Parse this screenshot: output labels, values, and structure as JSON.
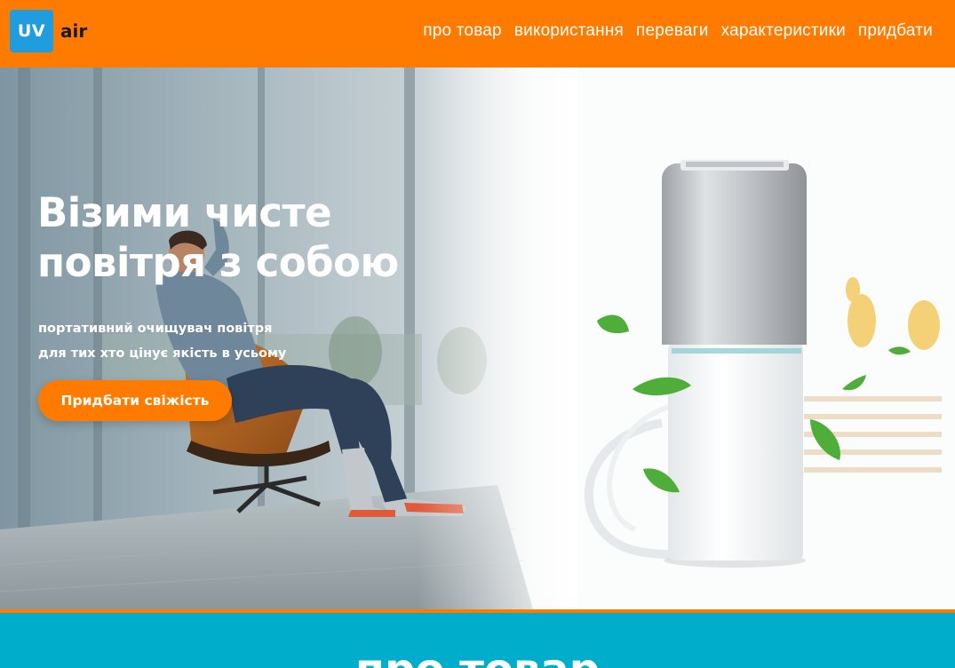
{
  "brand": {
    "logo_mark": "UV",
    "logo_text": "air",
    "primary_color": "#ff7b00",
    "logo_color": "#1f9ddf",
    "section_color": "#00aecb"
  },
  "nav": {
    "items": [
      {
        "label": "про товар"
      },
      {
        "label": "використання"
      },
      {
        "label": "переваги"
      },
      {
        "label": "характеристики"
      },
      {
        "label": "придбати"
      }
    ]
  },
  "hero": {
    "title_line1": "Візими чисте",
    "title_line2": "повітря з собою",
    "subtitle_line1": "портативний очищувач повітря",
    "subtitle_line2": "для тих хто цінує якість в усьому",
    "cta_label": "Придбати свіжість",
    "image_subjects": [
      "man-relaxing-in-lounge-chair",
      "portable-air-purifier",
      "green-leaves"
    ]
  },
  "section": {
    "title": "про товар"
  }
}
